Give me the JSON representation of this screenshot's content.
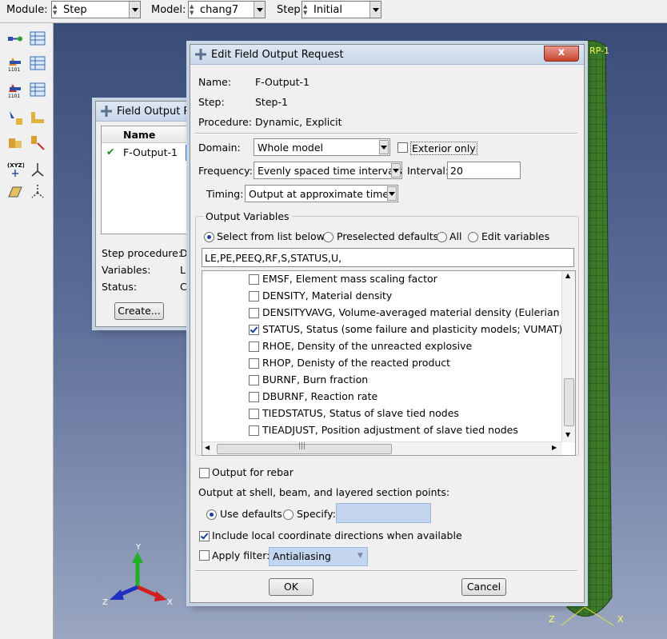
{
  "toolbar": {
    "module_label": "Module:",
    "module_value": "Step",
    "model_label": "Model:",
    "model_value": "chang7",
    "step_label": "Step:",
    "step_value": "Initial"
  },
  "viewport": {
    "rp_label": "RP-1",
    "triad": {
      "y": "Y",
      "x": "X",
      "z": "Z"
    },
    "corner_x": "X",
    "corner_z": "Z"
  },
  "manager": {
    "title": "Field Output Re",
    "col_name": "Name",
    "rows": [
      {
        "name": "F-Output-1"
      }
    ],
    "step_procedure_label": "Step procedure:",
    "step_procedure_value": "D",
    "variables_label": "Variables:",
    "variables_value": "LI",
    "status_label": "Status:",
    "status_value": "C",
    "create_button": "Create..."
  },
  "dialog": {
    "title": "Edit Field Output Request",
    "close_label": "x",
    "name_label": "Name:",
    "name_value": "F-Output-1",
    "step_label": "Step:",
    "step_value": "Step-1",
    "procedure_label": "Procedure:",
    "procedure_value": "Dynamic, Explicit",
    "domain_label": "Domain:",
    "domain_value": "Whole model",
    "exterior_only_label": "Exterior only",
    "exterior_only_checked": false,
    "frequency_label": "Frequency:",
    "frequency_value": "Evenly spaced time intervals",
    "interval_label": "Interval:",
    "interval_value": "20",
    "timing_label": "Timing:",
    "timing_value": "Output at approximate times",
    "output_variables_title": "Output Variables",
    "radio_options": [
      {
        "label": "Select from list below",
        "selected": true
      },
      {
        "label": "Preselected defaults",
        "selected": false
      },
      {
        "label": "All",
        "selected": false
      },
      {
        "label": "Edit variables",
        "selected": false
      }
    ],
    "variables_text": "LE,PE,PEEQ,RF,S,STATUS,U,",
    "variable_items": [
      {
        "label": "EMSF, Element mass scaling factor",
        "checked": false
      },
      {
        "label": "DENSITY, Material density",
        "checked": false
      },
      {
        "label": "DENSITYVAVG, Volume-averaged material density (Eulerian only",
        "checked": false
      },
      {
        "label": "STATUS, Status (some failure and plasticity models; VUMAT)",
        "checked": true
      },
      {
        "label": "RHOE, Density of the unreacted explosive",
        "checked": false
      },
      {
        "label": "RHOP, Denisty of the reacted product",
        "checked": false
      },
      {
        "label": "BURNF, Burn fraction",
        "checked": false
      },
      {
        "label": "DBURNF, Reaction rate",
        "checked": false
      },
      {
        "label": "TIEDSTATUS, Status of slave tied nodes",
        "checked": false
      },
      {
        "label": "TIEADJUST, Position adjustment of slave tied nodes",
        "checked": false
      }
    ],
    "output_rebar_label": "Output for rebar",
    "output_rebar_checked": false,
    "section_points_label": "Output at shell, beam, and layered section points:",
    "use_defaults_label": "Use defaults",
    "specify_label": "Specify:",
    "include_local_label": "Include local coordinate directions when available",
    "include_local_checked": true,
    "apply_filter_label": "Apply filter:",
    "apply_filter_checked": false,
    "filter_value": "Antialiasing",
    "ok_button": "OK",
    "cancel_button": "Cancel"
  },
  "colors": {
    "mesh_green": "#3d7a2a",
    "dialog_bg": "#f0f0f0",
    "selection_blue": "#1a3ea0",
    "disabled_field": "#c4d6ef"
  }
}
